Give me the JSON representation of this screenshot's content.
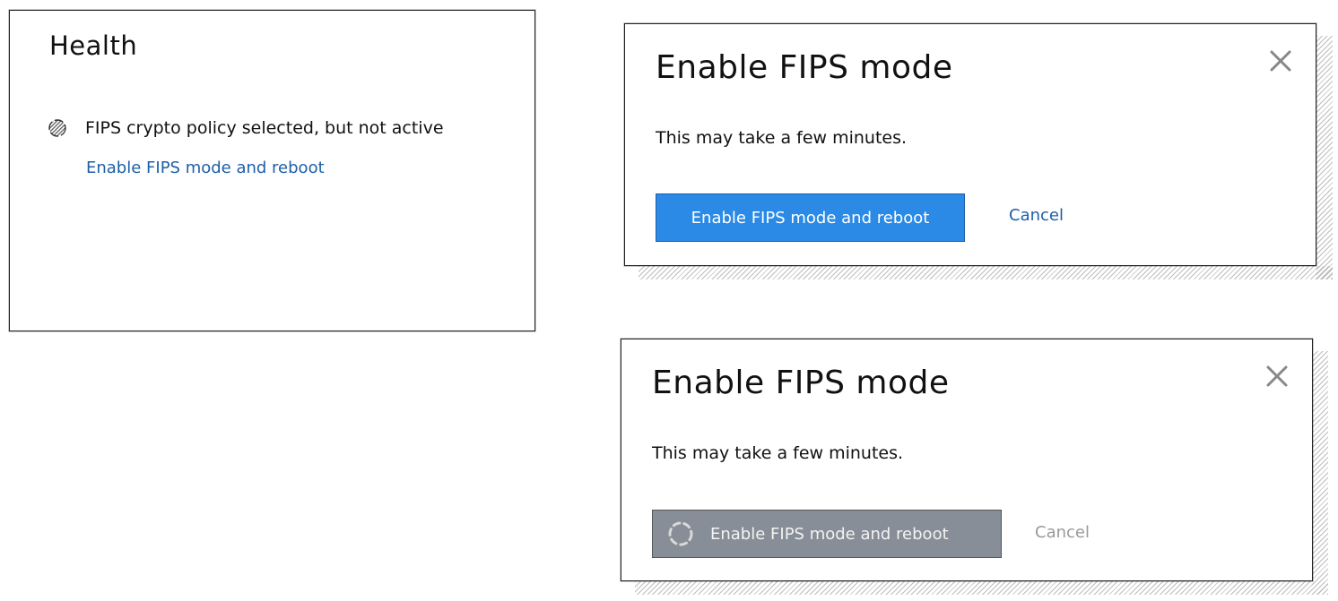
{
  "health": {
    "title": "Health",
    "status_message": "FIPS crypto policy selected, but not active",
    "action_link": "Enable FIPS mode and reboot",
    "status_icon": "spinner-icon"
  },
  "dialog_default": {
    "title": "Enable FIPS mode",
    "body": "This may take a few minutes.",
    "primary_button": "Enable FIPS mode and reboot",
    "cancel": "Cancel",
    "close_icon": "close-icon",
    "primary_color": "#2a8ae6",
    "link_color": "#1d5fa8"
  },
  "dialog_loading": {
    "title": "Enable FIPS mode",
    "body": "This may take a few minutes.",
    "primary_button": "Enable FIPS mode and reboot",
    "cancel": "Cancel",
    "close_icon": "close-icon",
    "button_icon": "loading-spinner-icon",
    "disabled_color": "#878e97"
  }
}
